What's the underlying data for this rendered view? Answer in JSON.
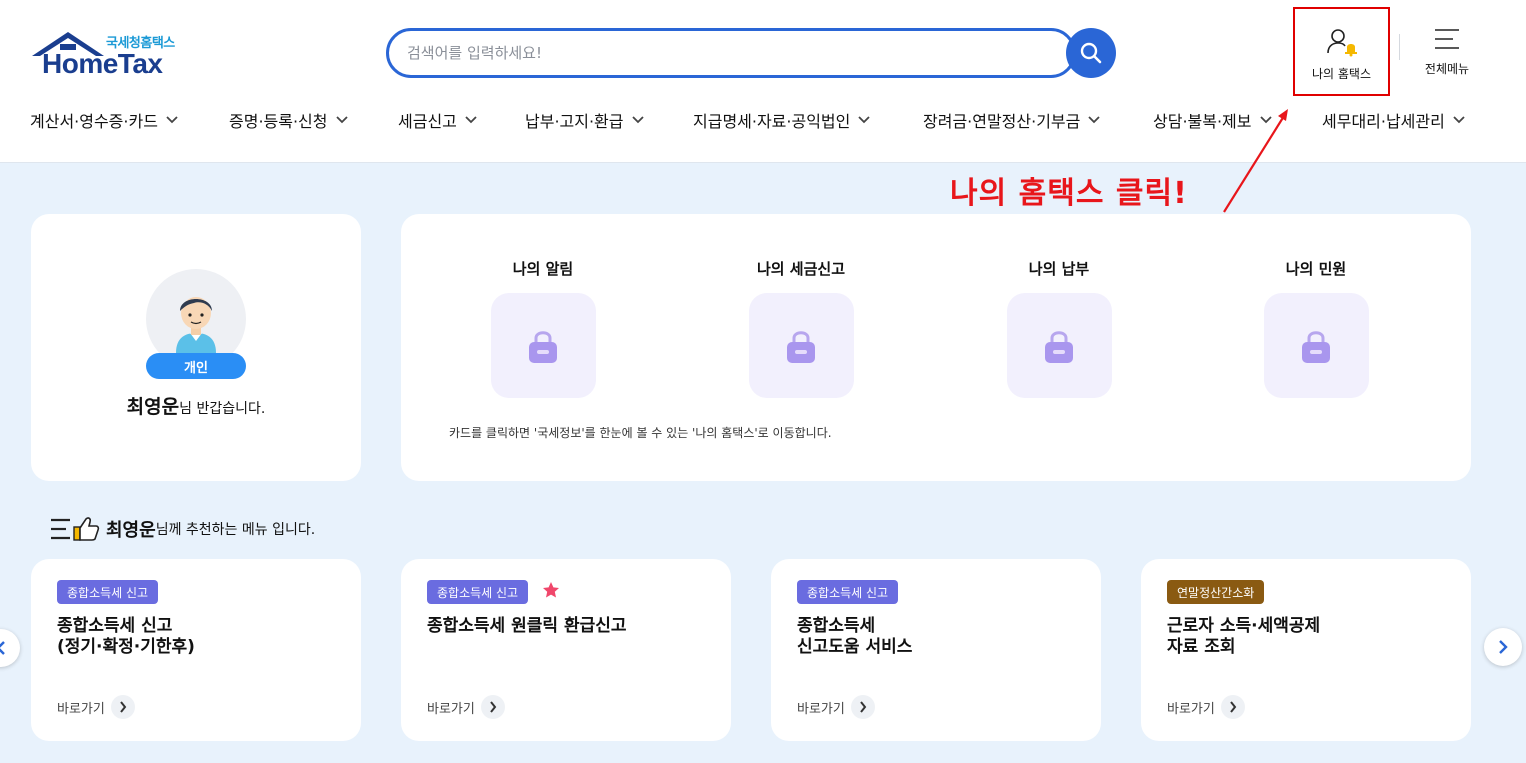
{
  "header": {
    "logo_sub": "국세청홈택스",
    "logo_main": "HomeTax",
    "search_placeholder": "검색어를 입력하세요!",
    "my_hometax_label": "나의 홈택스",
    "all_menu_label": "전체메뉴"
  },
  "nav": {
    "items": [
      {
        "label": "계산서·영수증·카드"
      },
      {
        "label": "증명·등록·신청"
      },
      {
        "label": "세금신고"
      },
      {
        "label": "납부·고지·환급"
      },
      {
        "label": "지급명세·자료·공익법인"
      },
      {
        "label": "장려금·연말정산·기부금"
      },
      {
        "label": "상담·불복·제보"
      },
      {
        "label": "세무대리·납세관리"
      }
    ]
  },
  "annotation": {
    "text": "나의 홈택스 클릭!",
    "color": "#e8161b"
  },
  "profile": {
    "badge": "개인",
    "name": "최영운",
    "greeting_suffix": "님 반갑습니다."
  },
  "summary": {
    "items": [
      {
        "title": "나의 알림",
        "icon": "lock-icon"
      },
      {
        "title": "나의 세금신고",
        "icon": "lock-icon"
      },
      {
        "title": "나의 납부",
        "icon": "lock-icon"
      },
      {
        "title": "나의 민원",
        "icon": "lock-icon"
      }
    ],
    "note": "카드를 클릭하면 '국세정보'를 한눈에 볼 수 있는 '나의 홈택스'로 이동합니다."
  },
  "recommend": {
    "name": "최영운",
    "suffix": "님께 추천하는 메뉴 입니다.",
    "cards": [
      {
        "tag": "종합소득세 신고",
        "tag_color": "#6a6ce0",
        "title": "종합소득세 신고\n(정기·확정·기한후)",
        "go": "바로가기",
        "starred": false
      },
      {
        "tag": "종합소득세 신고",
        "tag_color": "#6a6ce0",
        "title": "종합소득세 원클릭 환급신고",
        "go": "바로가기",
        "starred": true
      },
      {
        "tag": "종합소득세 신고",
        "tag_color": "#6a6ce0",
        "title": "종합소득세\n신고도움 서비스",
        "go": "바로가기",
        "starred": false
      },
      {
        "tag": "연말정산간소화",
        "tag_color": "#8a5a12",
        "title": "근로자 소득·세액공제\n자료 조회",
        "go": "바로가기",
        "starred": false
      }
    ]
  },
  "colors": {
    "primary": "#2a66d6",
    "background": "#e8f2fc",
    "accent_star": "#f0476b"
  }
}
